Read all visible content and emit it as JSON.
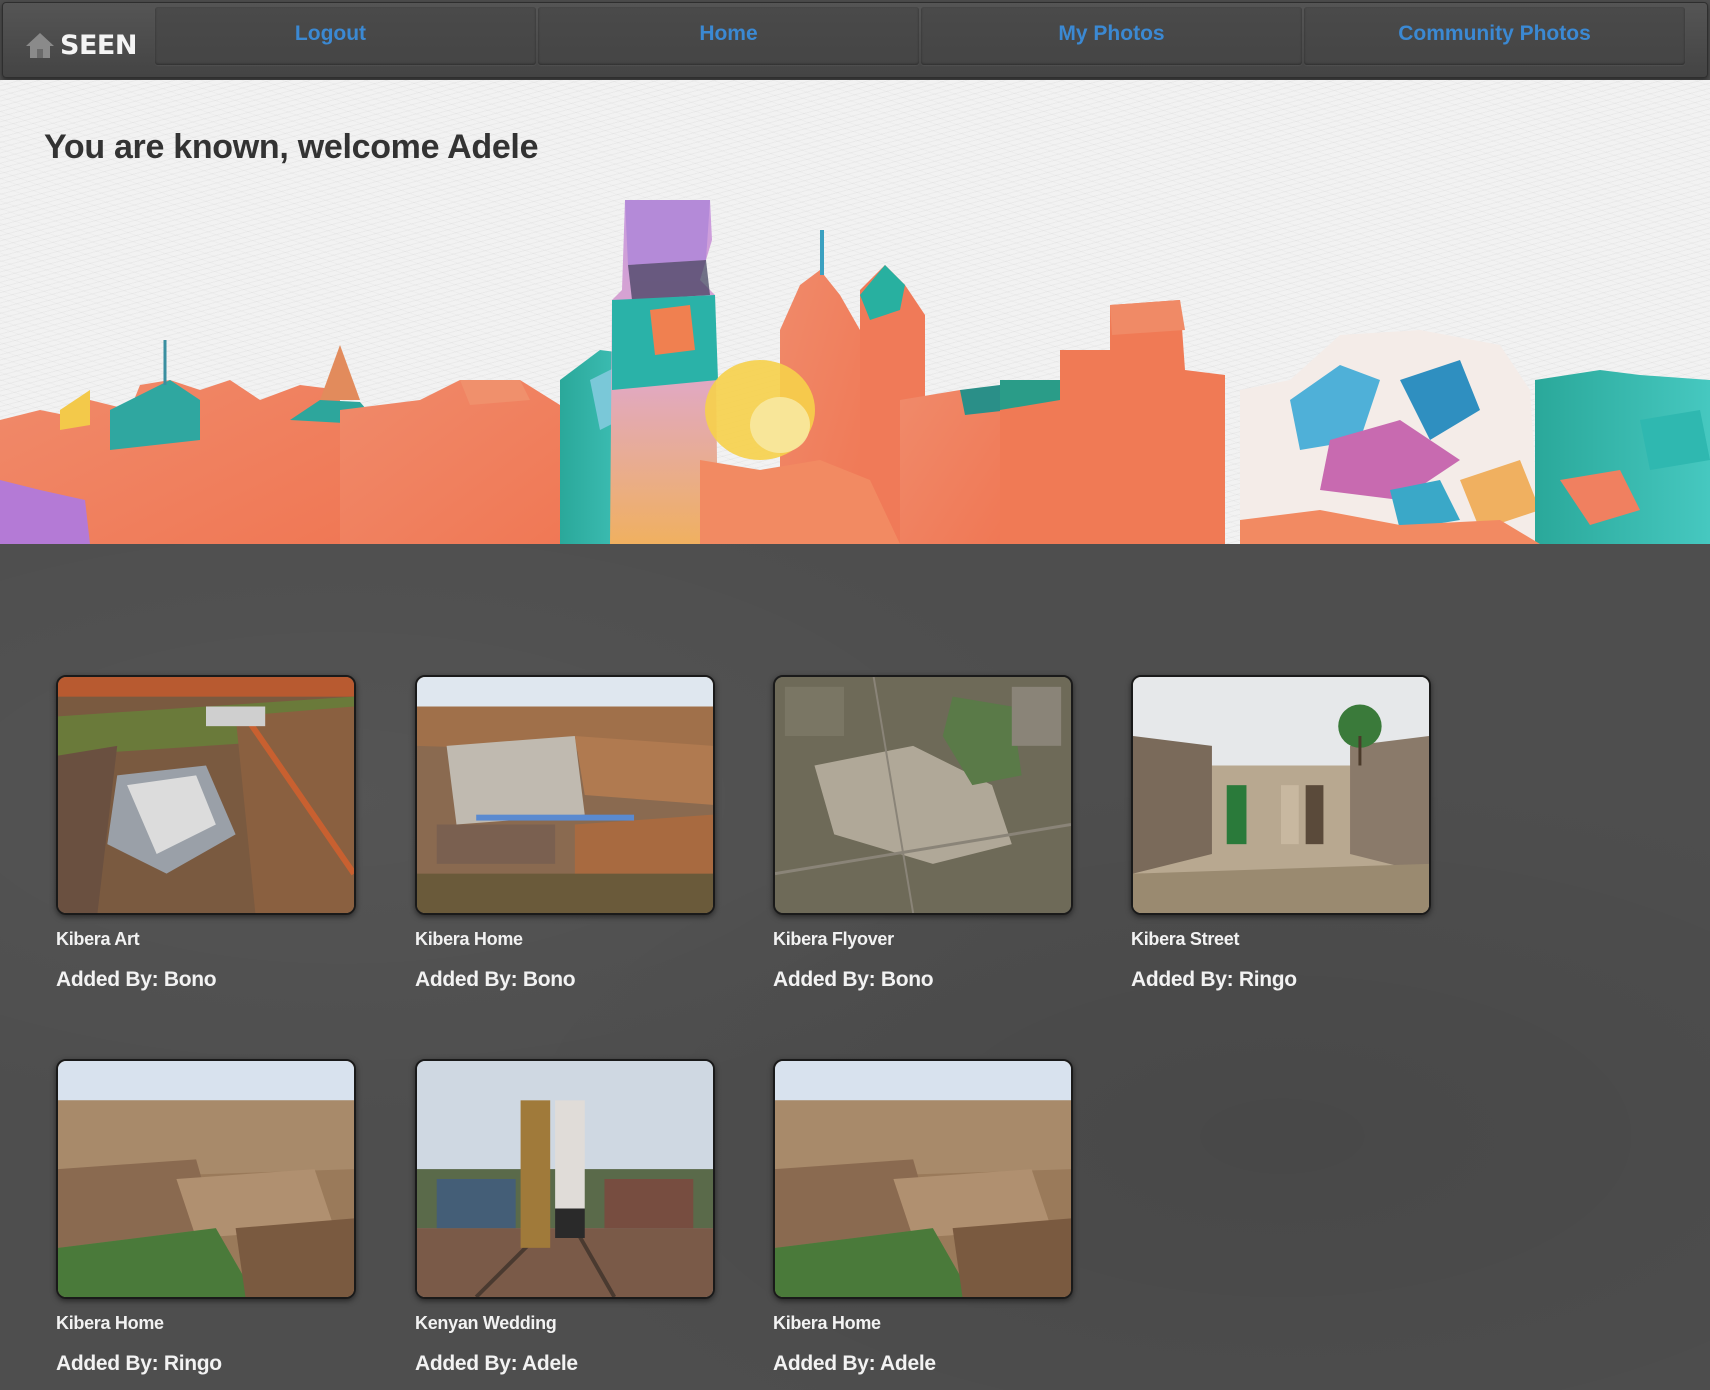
{
  "navbar": {
    "brand": "SEEN",
    "links": [
      "Logout",
      "Home",
      "My Photos",
      "Community Photos"
    ]
  },
  "hero": {
    "welcome": "You are known, welcome Adele"
  },
  "photos": [
    {
      "title": "Kibera Art",
      "added_by": "Added By: Bono"
    },
    {
      "title": "Kibera Home",
      "added_by": "Added By: Bono"
    },
    {
      "title": "Kibera Flyover",
      "added_by": "Added By: Bono"
    },
    {
      "title": "Kibera Street",
      "added_by": "Added By: Ringo"
    },
    {
      "title": "Kibera Home",
      "added_by": "Added By: Ringo"
    },
    {
      "title": "Kenyan Wedding",
      "added_by": "Added By: Adele"
    },
    {
      "title": "Kibera Home",
      "added_by": "Added By: Adele"
    }
  ],
  "colors": {
    "nav_link": "#3b89d3",
    "nav_bg": "#4a4a4a",
    "gallery_bg": "#4e4e4e",
    "text_light": "#f2f2f2"
  },
  "icons": {
    "brand": "home-icon"
  }
}
